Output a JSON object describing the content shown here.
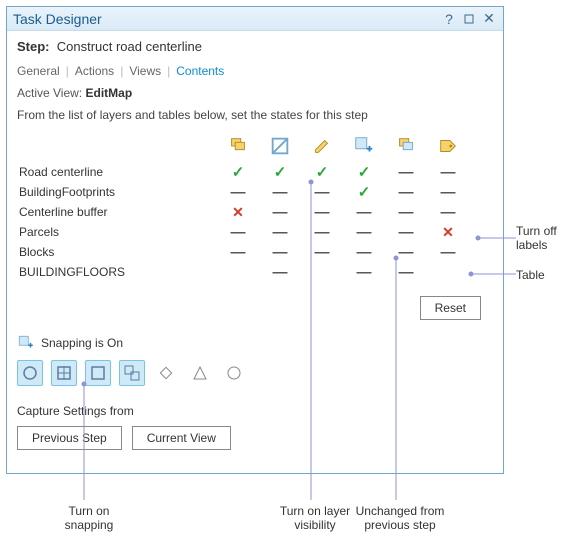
{
  "window": {
    "title": "Task Designer"
  },
  "step": {
    "label": "Step:",
    "name": "Construct road centerline"
  },
  "tabs": {
    "items": [
      "General",
      "Actions",
      "Views",
      "Contents"
    ],
    "active": "Contents"
  },
  "activeView": {
    "label": "Active View:",
    "value": "EditMap"
  },
  "instruction": "From the list of layers and tables below, set the states for this step",
  "columns": {
    "icons": [
      "selectable-icon",
      "visibility-icon",
      "editable-icon",
      "snapping-icon",
      "active-template-icon",
      "labels-icon"
    ]
  },
  "rows": [
    {
      "name": "Road centerline",
      "states": [
        "check",
        "check",
        "check",
        "check",
        "dash",
        "dash"
      ]
    },
    {
      "name": "BuildingFootprints",
      "states": [
        "dash",
        "dash",
        "dash",
        "check",
        "dash",
        "dash"
      ]
    },
    {
      "name": "Centerline buffer",
      "states": [
        "x",
        "dash",
        "dash",
        "dash",
        "dash",
        "dash"
      ]
    },
    {
      "name": "Parcels",
      "states": [
        "dash",
        "dash",
        "dash",
        "dash",
        "dash",
        "x"
      ]
    },
    {
      "name": "Blocks",
      "states": [
        "dash",
        "dash",
        "dash",
        "dash",
        "dash",
        "dash"
      ]
    },
    {
      "name": "BUILDINGFLOORS",
      "states": [
        "",
        "dash",
        "",
        "dash",
        "dash",
        ""
      ]
    }
  ],
  "reset": {
    "label": "Reset"
  },
  "snapping": {
    "label": "Snapping is On",
    "tools": [
      {
        "name": "point-snap",
        "selected": true
      },
      {
        "name": "end-snap",
        "selected": true
      },
      {
        "name": "vertex-snap",
        "selected": true
      },
      {
        "name": "edge-snap",
        "selected": true
      },
      {
        "name": "intersection-snap",
        "selected": false
      },
      {
        "name": "midpoint-snap",
        "selected": false
      },
      {
        "name": "tangent-snap",
        "selected": false
      }
    ]
  },
  "capture": {
    "label": "Capture Settings from",
    "previous": "Previous Step",
    "current": "Current View"
  },
  "annotations": {
    "turnOffLabels": "Turn off\nlabels",
    "table": "Table",
    "turnOnSnapping": "Turn on\nsnapping",
    "turnOnVisibility": "Turn on layer\nvisibility",
    "unchanged": "Unchanged from\nprevious step"
  }
}
